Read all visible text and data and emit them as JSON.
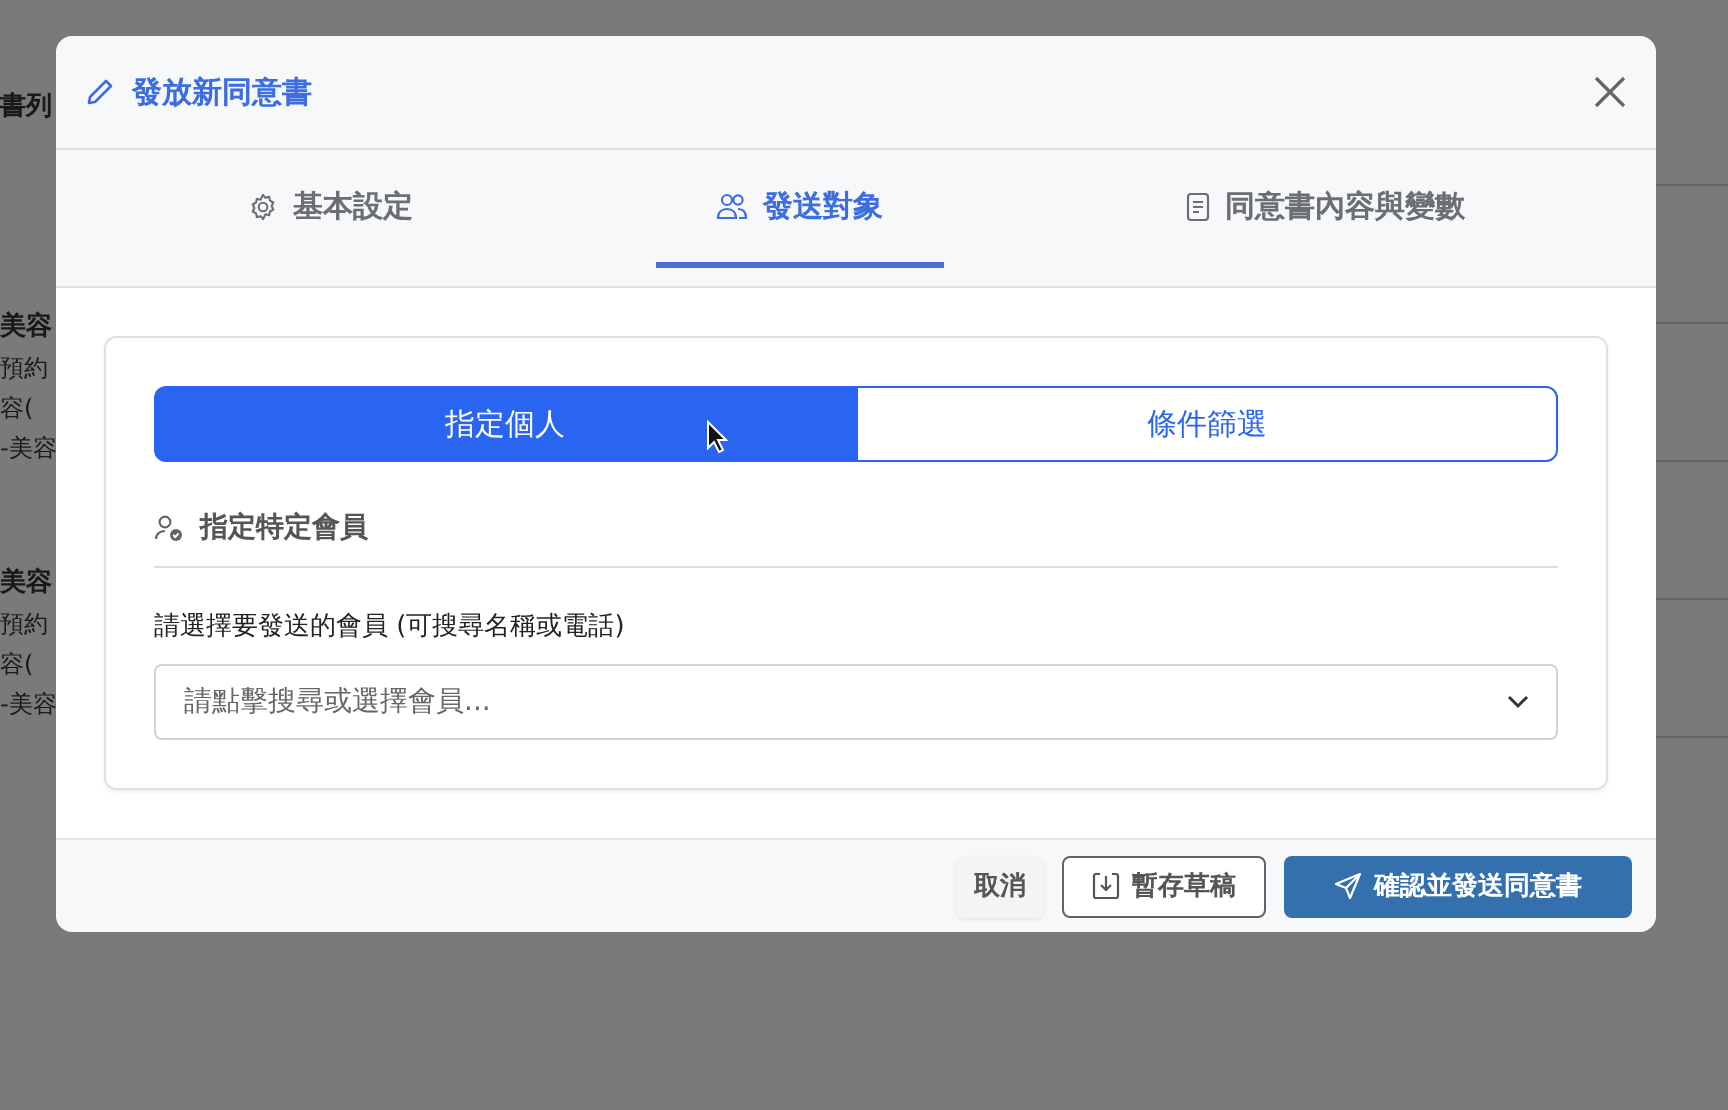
{
  "background": {
    "texts": [
      {
        "text": "書列",
        "kind": "heading"
      },
      {
        "text": "美容",
        "kind": "title"
      },
      {
        "text": "預約",
        "kind": "line"
      },
      {
        "text": "容(",
        "kind": "line"
      },
      {
        "text": "-美容",
        "kind": "line"
      },
      {
        "text": "美容",
        "kind": "title"
      },
      {
        "text": "預約",
        "kind": "line"
      },
      {
        "text": "容(",
        "kind": "line"
      },
      {
        "text": "-美容",
        "kind": "line"
      }
    ]
  },
  "dialog": {
    "title": "發放新同意書",
    "tabs": [
      {
        "label": "基本設定",
        "selected": false
      },
      {
        "label": "發送對象",
        "selected": true
      },
      {
        "label": "同意書內容與變數",
        "selected": false
      }
    ],
    "segments": [
      {
        "label": "指定個人",
        "selected": true
      },
      {
        "label": "條件篩選",
        "selected": false
      }
    ],
    "section_title": "指定特定會員",
    "member_field": {
      "label": "請選擇要發送的會員 (可搜尋名稱或電話)",
      "placeholder": "請點擊搜尋或選擇會員..."
    },
    "buttons": [
      {
        "label": "取消",
        "kind": "ghost"
      },
      {
        "label": "暫存草稿",
        "kind": "outline"
      },
      {
        "label": "確認並發送同意書",
        "kind": "primary"
      }
    ]
  }
}
